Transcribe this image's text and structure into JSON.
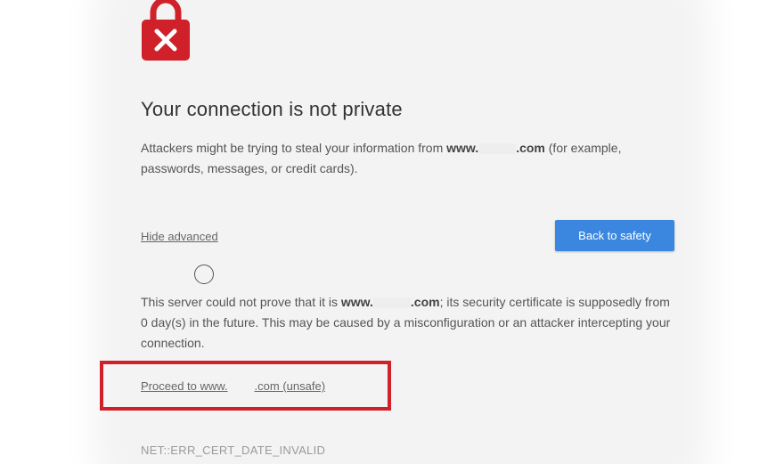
{
  "page": {
    "title": "Your connection is not private",
    "intro": {
      "before": "Attackers might be trying to steal your information from ",
      "domain_prefix": "www.",
      "domain_suffix": ".com",
      "after_line1": " (for example,",
      "line2": "passwords, messages, or credit cards)."
    },
    "hide_advanced_label": "Hide advanced",
    "back_to_safety_label": "Back to safety",
    "details": {
      "before": "This server could not prove that it is ",
      "domain_prefix": "www.",
      "domain_suffix": ".com",
      "after": "; its security certificate is supposedly from 0 day(s) in the future. This may be caused by a misconfiguration or an attacker intercepting your connection."
    },
    "proceed": {
      "prefix": "Proceed to www.",
      "suffix": ".com (unsafe)"
    },
    "error_code": "NET::ERR_CERT_DATE_INVALID"
  },
  "colors": {
    "lock_red": "#d0202a",
    "button_blue": "#3b87e0",
    "highlight_red": "#d0202a"
  },
  "icons": {
    "lock": "lock-error-icon",
    "cursor": "cursor-ring-icon"
  }
}
